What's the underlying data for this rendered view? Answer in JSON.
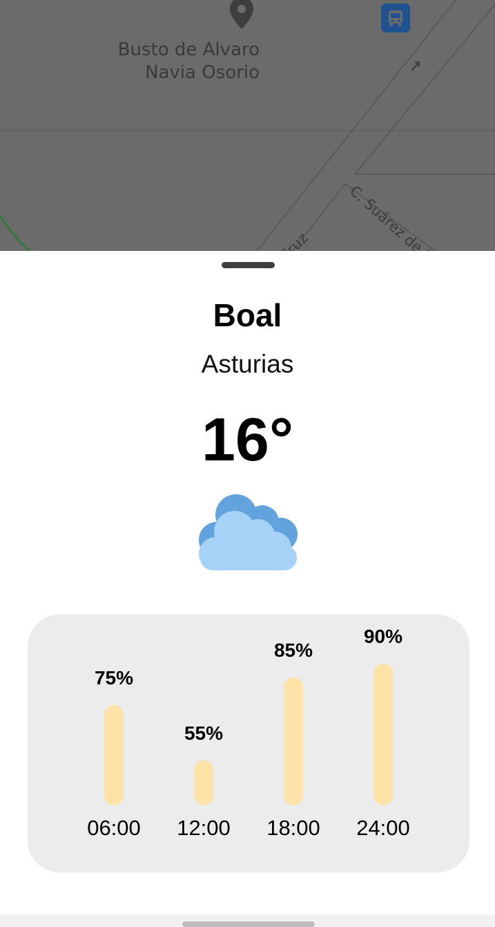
{
  "map": {
    "poi_name_line1": "Busto de Alvaro",
    "poi_name_line2": "Navia Osorio",
    "street_1": "C. Suárez de la",
    "street_2": "Cruz",
    "icons": [
      "map-pin-icon",
      "bus-stop-icon",
      "one-way-arrow-icon"
    ]
  },
  "weather": {
    "city": "Boal",
    "region": "Asturias",
    "temperature": "16°",
    "condition_icon": "cloud-icon"
  },
  "humidity": [
    {
      "time": "06:00",
      "label": "75%",
      "value": 75
    },
    {
      "time": "12:00",
      "label": "55%",
      "value": 55
    },
    {
      "time": "18:00",
      "label": "85%",
      "value": 85
    },
    {
      "time": "24:00",
      "label": "90%",
      "value": 90
    }
  ],
  "colors": {
    "map_overlay": "#6b6b6b",
    "bar_fill": "#fde3a7",
    "card_bg": "#ececec",
    "cloud_front": "#a6d2f7",
    "cloud_back": "#62a3dd",
    "bus_stop": "#20528f"
  }
}
